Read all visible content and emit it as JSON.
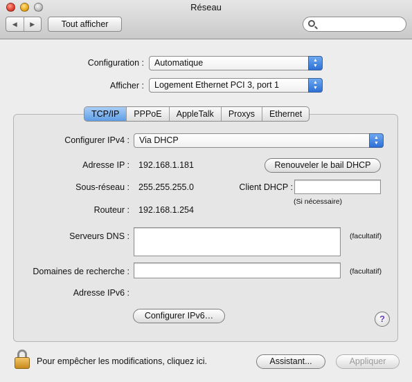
{
  "window": {
    "title": "Réseau"
  },
  "toolbar": {
    "back_glyph": "◀",
    "forward_glyph": "▶",
    "show_all_label": "Tout afficher",
    "search_placeholder": ""
  },
  "config": {
    "configuration_label": "Configuration :",
    "configuration_value": "Automatique",
    "show_label": "Afficher :",
    "show_value": "Logement Ethernet PCI 3, port 1"
  },
  "tabs": [
    {
      "label": "TCP/IP",
      "active": true
    },
    {
      "label": "PPPoE"
    },
    {
      "label": "AppleTalk"
    },
    {
      "label": "Proxys"
    },
    {
      "label": "Ethernet"
    }
  ],
  "tcpip": {
    "configure_ipv4_label": "Configurer IPv4 :",
    "configure_ipv4_value": "Via DHCP",
    "ip_label": "Adresse IP :",
    "ip_value": "192.168.1.181",
    "renew_button": "Renouveler le bail DHCP",
    "subnet_label": "Sous-réseau :",
    "subnet_value": "255.255.255.0",
    "dhcp_client_label": "Client DHCP :",
    "dhcp_client_value": "",
    "if_needed": "(Si nécessaire)",
    "router_label": "Routeur :",
    "router_value": "192.168.1.254",
    "dns_label": "Serveurs DNS :",
    "dns_value": "",
    "optional_1": "(facultatif)",
    "search_domains_label": "Domaines de recherche :",
    "search_domains_value": "",
    "optional_2": "(facultatif)",
    "ipv6_label": "Adresse IPv6 :",
    "configure_ipv6_button": "Configurer IPv6…",
    "help_glyph": "?"
  },
  "footer": {
    "lock_text": "Pour empêcher les modifications, cliquez ici.",
    "assistant_button": "Assistant...",
    "apply_button": "Appliquer"
  }
}
